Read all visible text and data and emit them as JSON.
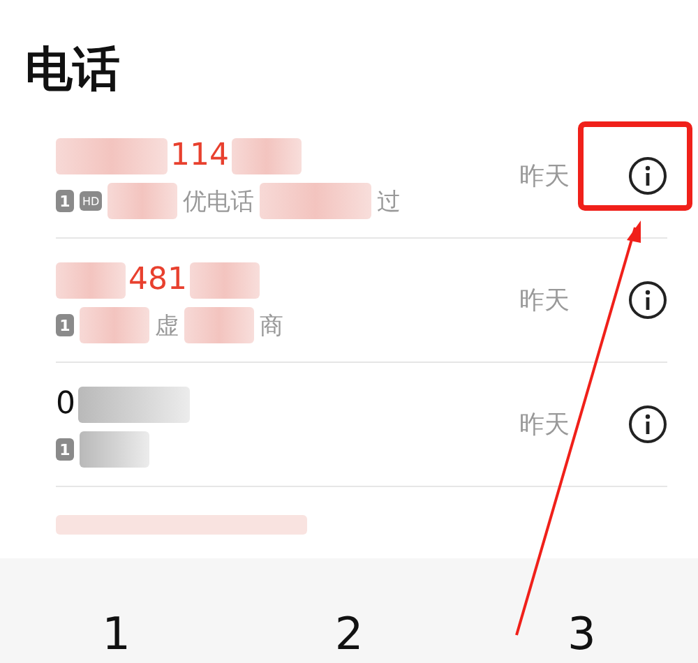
{
  "title": "电话",
  "calls": [
    {
      "missed": true,
      "highlighted": true,
      "time": "昨天",
      "name": [
        {
          "kind": "blur-long"
        },
        {
          "kind": "text",
          "text": "114"
        },
        {
          "kind": "blur-short"
        }
      ],
      "sub": [
        {
          "kind": "sim",
          "text": "1"
        },
        {
          "kind": "hd",
          "text": "HD"
        },
        {
          "kind": "blur-short"
        },
        {
          "kind": "text",
          "text": "优电话"
        },
        {
          "kind": "blur-long"
        },
        {
          "kind": "text",
          "text": "过"
        }
      ]
    },
    {
      "missed": true,
      "highlighted": false,
      "time": "昨天",
      "name": [
        {
          "kind": "blur-short"
        },
        {
          "kind": "text",
          "text": "481"
        },
        {
          "kind": "blur-short"
        }
      ],
      "sub": [
        {
          "kind": "sim",
          "text": "1"
        },
        {
          "kind": "blur-short"
        },
        {
          "kind": "text",
          "text": "虚"
        },
        {
          "kind": "blur-short"
        },
        {
          "kind": "text",
          "text": "商"
        }
      ]
    },
    {
      "missed": false,
      "highlighted": false,
      "time": "昨天",
      "name": [
        {
          "kind": "text",
          "text": "0"
        },
        {
          "kind": "blur-long"
        }
      ],
      "sub": [
        {
          "kind": "sim",
          "text": "1"
        },
        {
          "kind": "blur-short"
        }
      ]
    }
  ],
  "keypad": [
    "1",
    "2",
    "3"
  ]
}
